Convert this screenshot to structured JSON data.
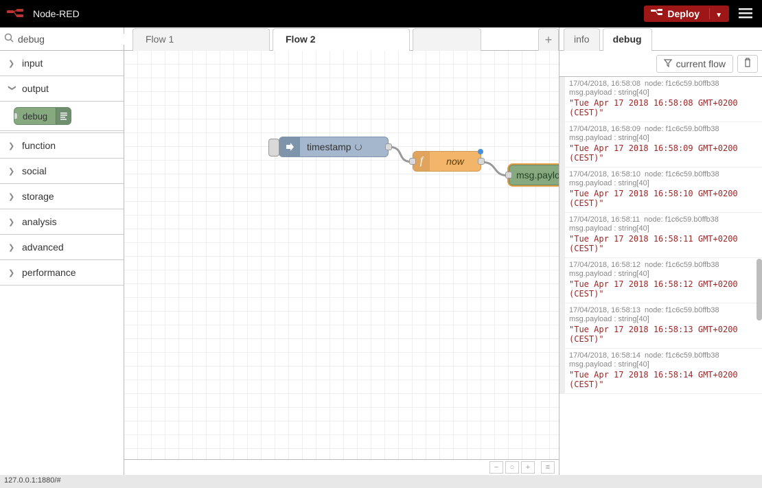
{
  "header": {
    "app_title": "Node-RED",
    "deploy_label": "Deploy"
  },
  "palette": {
    "search_value": "debug",
    "categories": [
      {
        "label": "input",
        "expanded": false
      },
      {
        "label": "output",
        "expanded": true
      },
      {
        "label": "function",
        "expanded": false
      },
      {
        "label": "social",
        "expanded": false
      },
      {
        "label": "storage",
        "expanded": false
      },
      {
        "label": "analysis",
        "expanded": false
      },
      {
        "label": "advanced",
        "expanded": false
      },
      {
        "label": "performance",
        "expanded": false
      }
    ],
    "output_node": {
      "label": "debug"
    }
  },
  "workspace": {
    "tabs": [
      {
        "label": "Flow 1",
        "active": false
      },
      {
        "label": "Flow 2",
        "active": true
      }
    ],
    "nodes": {
      "inject": {
        "label": "timestamp"
      },
      "function": {
        "label": "now"
      },
      "debug": {
        "label": "msg.payload"
      }
    }
  },
  "right_panel": {
    "tabs": [
      {
        "label": "info",
        "active": false
      },
      {
        "label": "debug",
        "active": true
      }
    ],
    "filter_label": "current flow",
    "entries": [
      {
        "time": "17/04/2018, 16:58:08",
        "node": "node: f1c6c59.b0ffb38",
        "topic": "msg.payload : string[40]",
        "msg": "\"Tue Apr 17 2018 16:58:08 GMT+0200 (CEST)\""
      },
      {
        "time": "17/04/2018, 16:58:09",
        "node": "node: f1c6c59.b0ffb38",
        "topic": "msg.payload : string[40]",
        "msg": "\"Tue Apr 17 2018 16:58:09 GMT+0200 (CEST)\""
      },
      {
        "time": "17/04/2018, 16:58:10",
        "node": "node: f1c6c59.b0ffb38",
        "topic": "msg.payload : string[40]",
        "msg": "\"Tue Apr 17 2018 16:58:10 GMT+0200 (CEST)\""
      },
      {
        "time": "17/04/2018, 16:58:11",
        "node": "node: f1c6c59.b0ffb38",
        "topic": "msg.payload : string[40]",
        "msg": "\"Tue Apr 17 2018 16:58:11 GMT+0200 (CEST)\""
      },
      {
        "time": "17/04/2018, 16:58:12",
        "node": "node: f1c6c59.b0ffb38",
        "topic": "msg.payload : string[40]",
        "msg": "\"Tue Apr 17 2018 16:58:12 GMT+0200 (CEST)\""
      },
      {
        "time": "17/04/2018, 16:58:13",
        "node": "node: f1c6c59.b0ffb38",
        "topic": "msg.payload : string[40]",
        "msg": "\"Tue Apr 17 2018 16:58:13 GMT+0200 (CEST)\""
      },
      {
        "time": "17/04/2018, 16:58:14",
        "node": "node: f1c6c59.b0ffb38",
        "topic": "msg.payload : string[40]",
        "msg": "\"Tue Apr 17 2018 16:58:14 GMT+0200 (CEST)\""
      }
    ]
  },
  "status_bar": {
    "text": "127.0.0.1:1880/#"
  }
}
